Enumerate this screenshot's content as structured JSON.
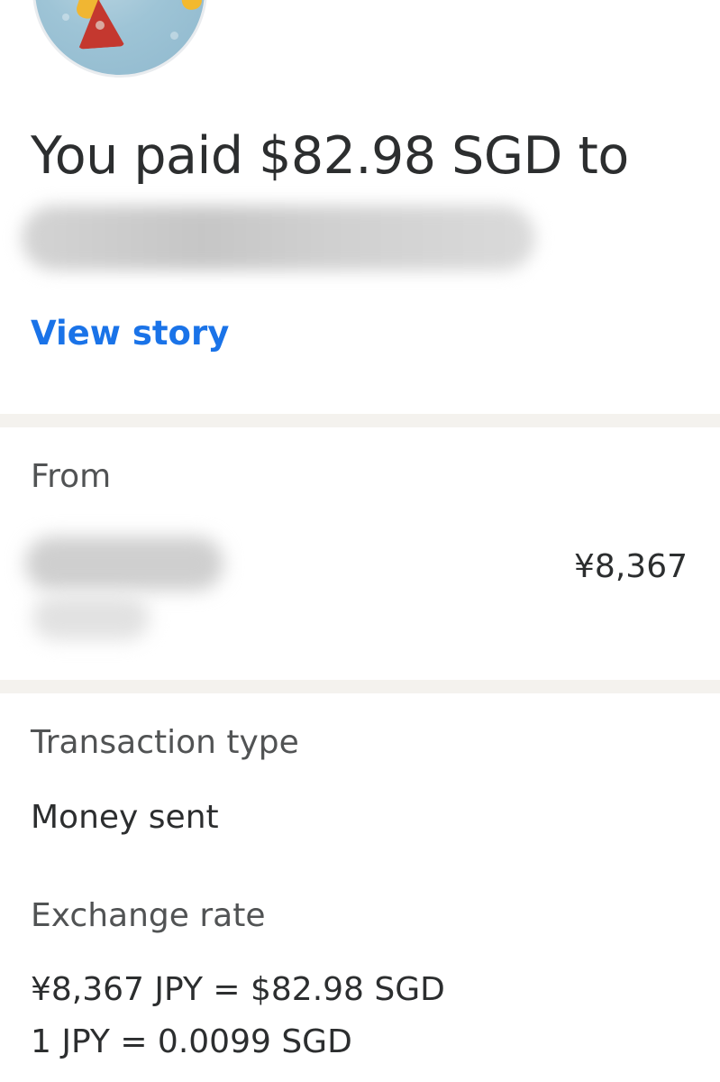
{
  "header": {
    "title": "You paid $82.98 SGD to",
    "recipient_name_hidden": "",
    "view_story_link": "View story"
  },
  "from_section": {
    "label": "From",
    "amount": "¥8,367"
  },
  "transaction": {
    "type_label": "Transaction type",
    "type_value": "Money sent",
    "exchange_label": "Exchange rate",
    "exchange_line1": "¥8,367 JPY = $82.98 SGD",
    "exchange_line2": "1 JPY = 0.0099 SGD"
  },
  "colors": {
    "link": "#1a73e8",
    "divider": "#f4f2ee",
    "text": "#2c2e2f"
  }
}
